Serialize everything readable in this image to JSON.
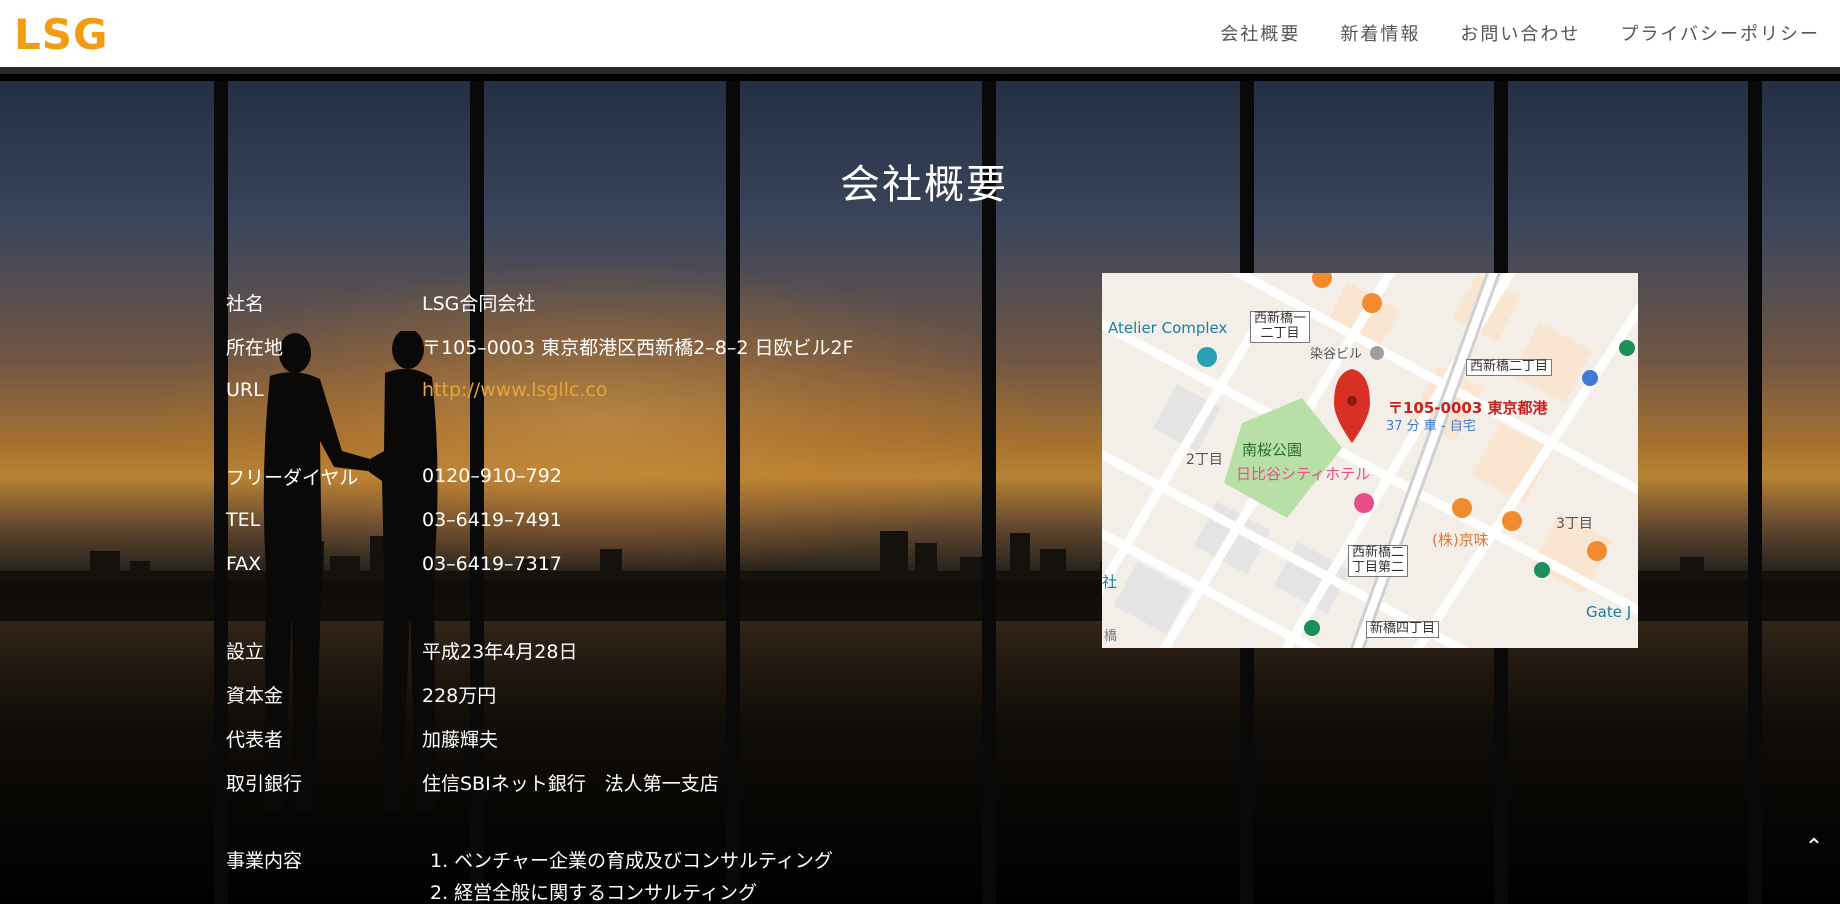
{
  "header": {
    "logo": "LSG",
    "nav": [
      {
        "label": "会社概要"
      },
      {
        "label": "新着情報"
      },
      {
        "label": "お問い合わせ"
      },
      {
        "label": "プライバシーポリシー"
      }
    ]
  },
  "main": {
    "title": "会社概要",
    "rows": [
      {
        "key": "社名",
        "value": "LSG合同会社"
      },
      {
        "key": "所在地",
        "value": "〒105–0003 東京都港区西新橋2–8–2 日欧ビル2F"
      },
      {
        "key": "URL",
        "value": "http://www.lsgllc.co"
      },
      {
        "key": "フリーダイヤル",
        "value": "0120–910–792"
      },
      {
        "key": "TEL",
        "value": "03–6419–7491"
      },
      {
        "key": "FAX",
        "value": "03–6419–7317"
      },
      {
        "key": "設立",
        "value": "平成23年4月28日"
      },
      {
        "key": "資本金",
        "value": "228万円"
      },
      {
        "key": "代表者",
        "value": "加藤輝夫"
      },
      {
        "key": "取引銀行",
        "value": "住信SBIネット銀行　法人第一支店"
      }
    ],
    "business": {
      "key": "事業内容",
      "items": [
        "1. ベンチャー企業の育成及びコンサルティング",
        "2. 経営全般に関するコンサルティング"
      ]
    }
  },
  "map": {
    "labels": {
      "atelier": "Atelier Complex",
      "nishi1": "西新橋一\n二丁目",
      "somei": "染谷ビル",
      "nishi2": "西新橋二丁目",
      "pin": "〒105-0003 東京都港",
      "pin_sub": "37 分 車 - 自宅",
      "park": "南桜公園",
      "hotel": "日比谷シティホテル",
      "chome2": "2丁目",
      "chome3": "3丁目",
      "kyomi": "(株)京味",
      "nishi3": "西新橋二\n丁目第二",
      "shinbashi4": "新橋四丁目",
      "gate": "Gate J",
      "sha": "社",
      "hashi": "橋"
    },
    "colors": {
      "pin": "#d93025",
      "park": "#b8e0a6",
      "road": "#ffffff",
      "food": "#f28b30",
      "hotel": "#e94e8a"
    }
  },
  "ui": {
    "scroll_top_icon": "chevron-up-icon",
    "scroll_top_glyph": "⌃"
  }
}
